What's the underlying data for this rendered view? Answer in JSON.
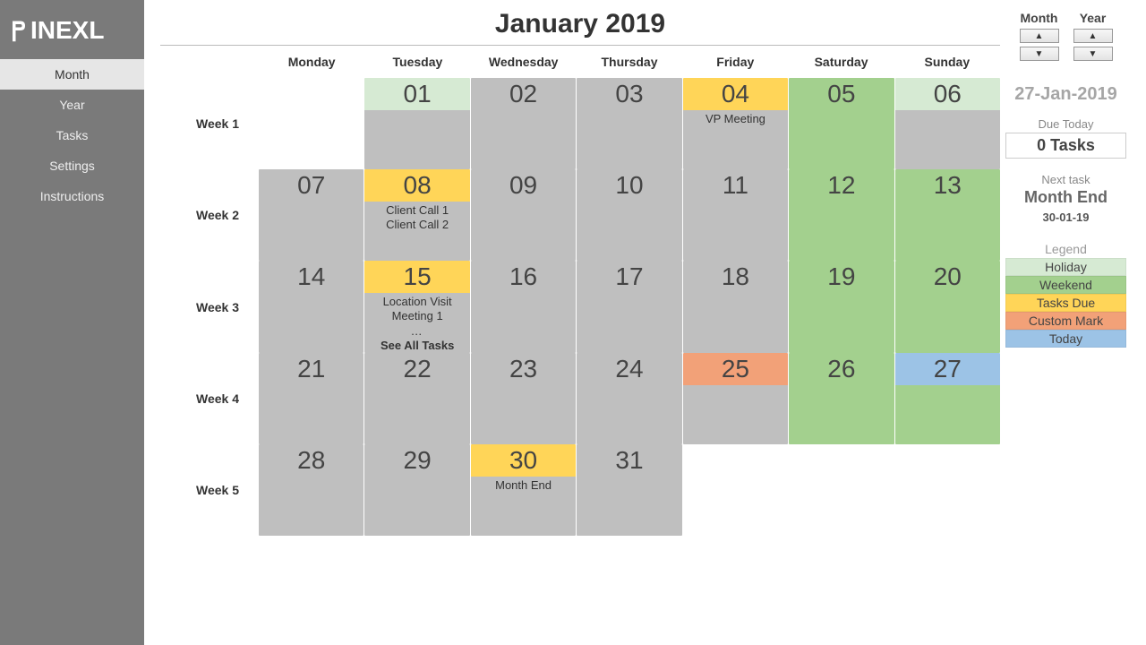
{
  "brand": "INEXL",
  "sidebar": {
    "items": [
      {
        "label": "Month",
        "active": true
      },
      {
        "label": "Year",
        "active": false
      },
      {
        "label": "Tasks",
        "active": false
      },
      {
        "label": "Settings",
        "active": false
      },
      {
        "label": "Instructions",
        "active": false
      }
    ]
  },
  "calendar": {
    "title": "January 2019",
    "day_headers": [
      "Monday",
      "Tuesday",
      "Wednesday",
      "Thursday",
      "Friday",
      "Saturday",
      "Sunday"
    ],
    "week_labels": [
      "Week 1",
      "Week 2",
      "Week 3",
      "Week 4",
      "Week 5"
    ],
    "weeks": [
      [
        {
          "type": "empty"
        },
        {
          "day": "01",
          "type": "holiday"
        },
        {
          "day": "02",
          "type": "default"
        },
        {
          "day": "03",
          "type": "default"
        },
        {
          "day": "04",
          "type": "task",
          "tasks": [
            "VP Meeting"
          ]
        },
        {
          "day": "05",
          "type": "weekend"
        },
        {
          "day": "06",
          "type": "holiday"
        }
      ],
      [
        {
          "day": "07",
          "type": "default"
        },
        {
          "day": "08",
          "type": "task",
          "tasks": [
            "Client Call 1",
            "Client Call 2"
          ]
        },
        {
          "day": "09",
          "type": "default"
        },
        {
          "day": "10",
          "type": "default"
        },
        {
          "day": "11",
          "type": "default"
        },
        {
          "day": "12",
          "type": "weekend"
        },
        {
          "day": "13",
          "type": "weekend"
        }
      ],
      [
        {
          "day": "14",
          "type": "default"
        },
        {
          "day": "15",
          "type": "task",
          "tasks": [
            "Location Visit",
            "Meeting 1"
          ],
          "overflow": true,
          "see_all": "See All Tasks"
        },
        {
          "day": "16",
          "type": "default"
        },
        {
          "day": "17",
          "type": "default"
        },
        {
          "day": "18",
          "type": "default"
        },
        {
          "day": "19",
          "type": "weekend"
        },
        {
          "day": "20",
          "type": "weekend"
        }
      ],
      [
        {
          "day": "21",
          "type": "default"
        },
        {
          "day": "22",
          "type": "default"
        },
        {
          "day": "23",
          "type": "default"
        },
        {
          "day": "24",
          "type": "default"
        },
        {
          "day": "25",
          "type": "custom"
        },
        {
          "day": "26",
          "type": "weekend"
        },
        {
          "day": "27",
          "type": "today"
        }
      ],
      [
        {
          "day": "28",
          "type": "default"
        },
        {
          "day": "29",
          "type": "default"
        },
        {
          "day": "30",
          "type": "task",
          "tasks": [
            "Month End"
          ]
        },
        {
          "day": "31",
          "type": "default"
        },
        {
          "type": "empty"
        },
        {
          "type": "empty"
        },
        {
          "type": "empty"
        }
      ]
    ]
  },
  "right": {
    "month_label": "Month",
    "year_label": "Year",
    "today": "27-Jan-2019",
    "due_label": "Due Today",
    "due_value": "0 Tasks",
    "next_label": "Next task",
    "next_value": "Month End",
    "next_date": "30-01-19",
    "legend_title": "Legend",
    "legend": [
      {
        "label": "Holiday",
        "cls": "lg-holiday"
      },
      {
        "label": "Weekend",
        "cls": "lg-weekend"
      },
      {
        "label": "Tasks Due",
        "cls": "lg-task"
      },
      {
        "label": "Custom Mark",
        "cls": "lg-custom"
      },
      {
        "label": "Today",
        "cls": "lg-today"
      }
    ]
  }
}
